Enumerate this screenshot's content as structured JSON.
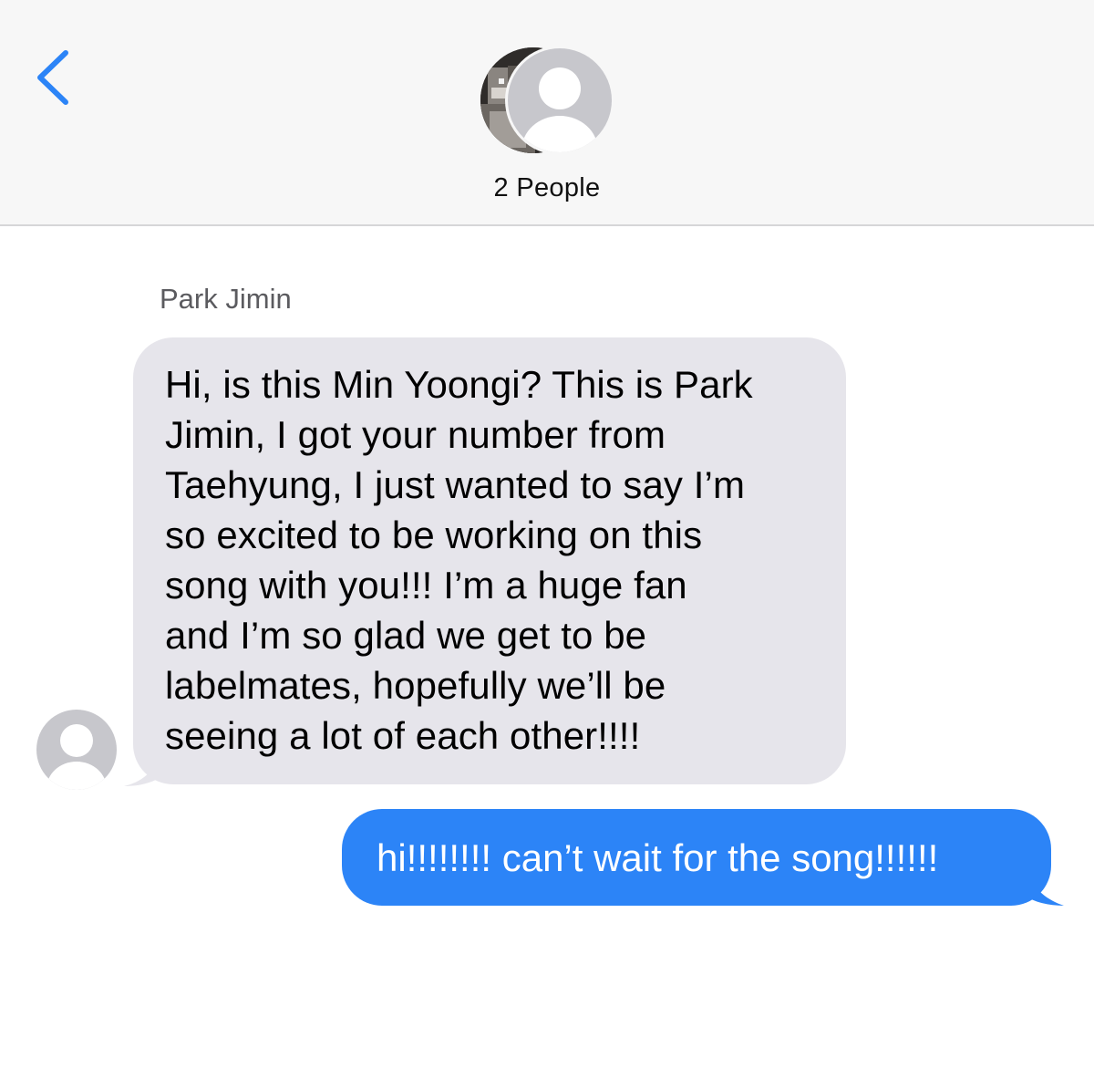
{
  "header": {
    "back_icon": "chevron-left-icon",
    "group_name": "2 People",
    "avatars": [
      "contact-photo",
      "default-person-icon"
    ]
  },
  "conversation": {
    "messages": [
      {
        "direction": "incoming",
        "sender": "Park Jimin",
        "text": "Hi, is this Min Yoongi? This is Park\nJimin, I got your number from\nTaehyung, I just wanted to say I’m\nso excited to be working on this\nsong with you!!! I’m a huge fan\nand I’m so glad we get to be\nlabelmates, hopefully we’ll be\nseeing a lot of each other!!!!"
      },
      {
        "direction": "outgoing",
        "text": "hi!!!!!!!! can’t wait for the song!!!!!!"
      }
    ]
  },
  "colors": {
    "accent": "#2c84f7",
    "incoming_bubble": "#e6e5eb",
    "header_bg": "#f7f7f7",
    "avatar_gray": "#c7c7cc"
  }
}
